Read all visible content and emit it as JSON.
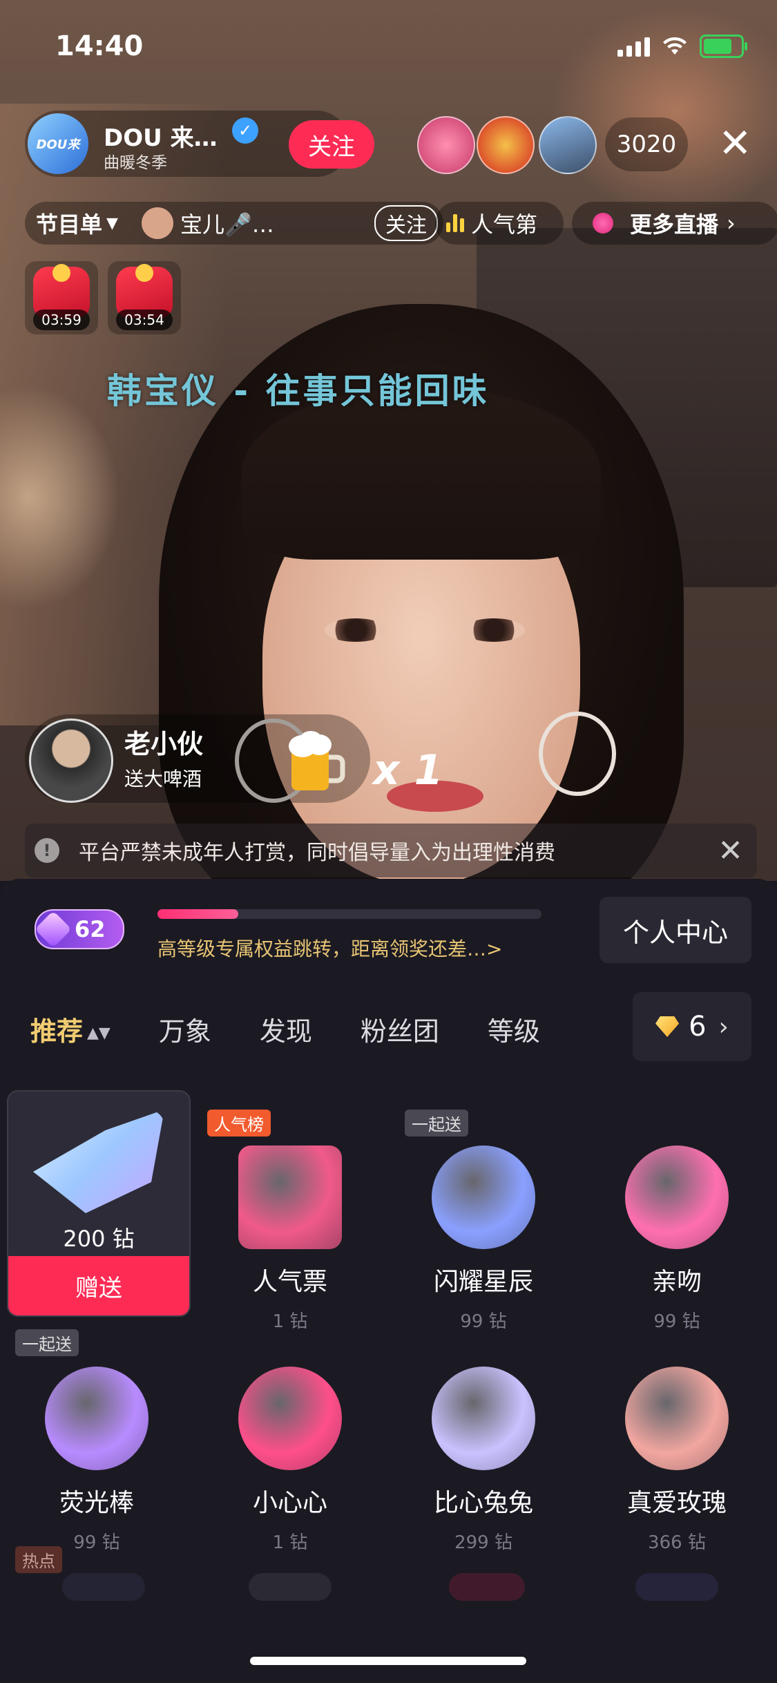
{
  "status_bar": {
    "time": "14:40"
  },
  "header": {
    "host_name": "DOU 来…",
    "host_subtitle": "曲暖冬季",
    "avatar_text": "DOU来",
    "follow_label": "关注",
    "viewer_count": "3020"
  },
  "program_bar": {
    "program_label": "节目单",
    "performer": "宝儿🎤…",
    "follow_label": "关注",
    "rank_label": "人气第",
    "more_label": "更多直播"
  },
  "red_packets": [
    {
      "timer": "03:59"
    },
    {
      "timer": "03:54"
    }
  ],
  "song_title": "韩宝仪 - 往事只能回味",
  "gift_notification": {
    "user": "老小伙",
    "action": "送大啤酒",
    "multiplier": "x 1"
  },
  "notice": {
    "text": "平台严禁未成年人打赏，同时倡导量入为出理性消费"
  },
  "panel": {
    "level": "62",
    "level_progress": 0.21,
    "level_text": "高等级专属权益跳转，距离领奖还差…>",
    "personal_center": "个人中心",
    "tabs": [
      "推荐",
      "万象",
      "发现",
      "粉丝团",
      "等级"
    ],
    "balance": "6",
    "selected_gift": {
      "price": "200 钻",
      "send_label": "赠送"
    },
    "gifts": [
      {
        "name": "人气票",
        "price": "1 钻",
        "tag": "人气榜",
        "color": "#f05a8a"
      },
      {
        "name": "闪耀星辰",
        "price": "99 钻",
        "tag": "一起送",
        "color": "#8aa0ff"
      },
      {
        "name": "亲吻",
        "price": "99 钻",
        "tag": "",
        "color": "#ff6fb0"
      },
      {
        "name": "荧光棒",
        "price": "99 钻",
        "tag": "一起送",
        "color": "#b88bff"
      },
      {
        "name": "小心心",
        "price": "1 钻",
        "tag": "",
        "color": "#ff4f8a"
      },
      {
        "name": "比心兔兔",
        "price": "299 钻",
        "tag": "",
        "color": "#c9c2ff"
      },
      {
        "name": "真爱玫瑰",
        "price": "366 钻",
        "tag": "",
        "color": "#f2a6a0"
      }
    ],
    "hot_tag": "热点"
  }
}
